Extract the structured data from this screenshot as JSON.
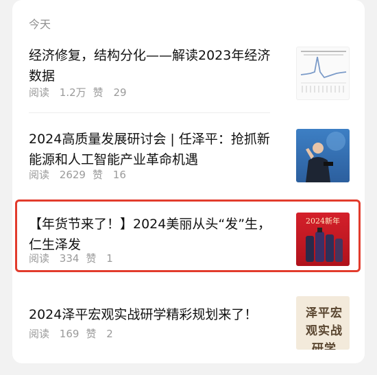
{
  "section": {
    "label": "今天"
  },
  "articles": [
    {
      "title": "经济修复，结构分化——解读2023年经济数据",
      "reads_label": "阅读",
      "reads": "1.2万",
      "likes_label": "赞",
      "likes": "29"
    },
    {
      "title": "2024高质量发展研讨会 | 任泽平：抢抓新能源和人工智能产业革命机遇",
      "reads_label": "阅读",
      "reads": "2629",
      "likes_label": "赞",
      "likes": "16"
    },
    {
      "title": "【年货节来了！】2024美丽从头“发”生，仁生泽发",
      "reads_label": "阅读",
      "reads": "334",
      "likes_label": "赞",
      "likes": "1"
    },
    {
      "title": "2024泽平宏观实战研学精彩规划来了！",
      "reads_label": "阅读",
      "reads": "169",
      "likes_label": "赞",
      "likes": "2"
    }
  ],
  "thumbnails": {
    "t3_text": "2024新年",
    "t4_text": "泽平宏观实战研学"
  },
  "colors": {
    "highlight": "#e23b2c",
    "title": "#111111",
    "meta": "#9a9a9a"
  }
}
